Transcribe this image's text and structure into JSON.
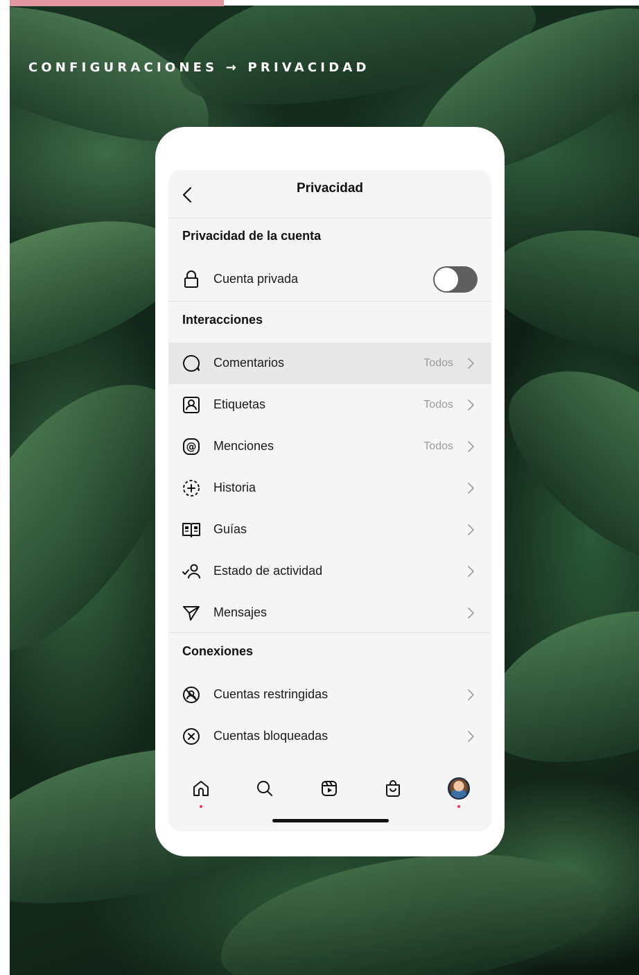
{
  "header": {
    "breadcrumb": "CONFIGURACIONES → PRIVACIDAD"
  },
  "nav": {
    "title": "Privacidad",
    "back_icon": "chevron-left-icon"
  },
  "sections": {
    "account": {
      "title": "Privacidad de la cuenta",
      "private_account": {
        "label": "Cuenta privada",
        "icon": "lock-icon",
        "toggle_on": false
      }
    },
    "interactions": {
      "title": "Interacciones",
      "items": [
        {
          "label": "Comentarios",
          "value": "Todos",
          "icon": "comment-icon",
          "highlighted": true
        },
        {
          "label": "Etiquetas",
          "value": "Todos",
          "icon": "tag-person-icon"
        },
        {
          "label": "Menciones",
          "value": "Todos",
          "icon": "at-sign-icon"
        },
        {
          "label": "Historia",
          "value": "",
          "icon": "story-add-icon"
        },
        {
          "label": "Guías",
          "value": "",
          "icon": "guide-book-icon"
        },
        {
          "label": "Estado de actividad",
          "value": "",
          "icon": "activity-status-icon"
        },
        {
          "label": "Mensajes",
          "value": "",
          "icon": "paper-plane-icon"
        }
      ]
    },
    "connections": {
      "title": "Conexiones",
      "items": [
        {
          "label": "Cuentas restringidas",
          "icon": "restricted-icon"
        },
        {
          "label": "Cuentas bloqueadas",
          "icon": "blocked-icon"
        }
      ]
    }
  },
  "tabbar": {
    "items": [
      "home-icon",
      "search-icon",
      "reels-icon",
      "shop-icon",
      "profile-avatar"
    ],
    "notification_color": "#ff2d55"
  },
  "colors": {
    "accent_pink": "#e2969f",
    "toggle_off": "#5f5f5f",
    "highlight_row": "#e8e8e8"
  }
}
